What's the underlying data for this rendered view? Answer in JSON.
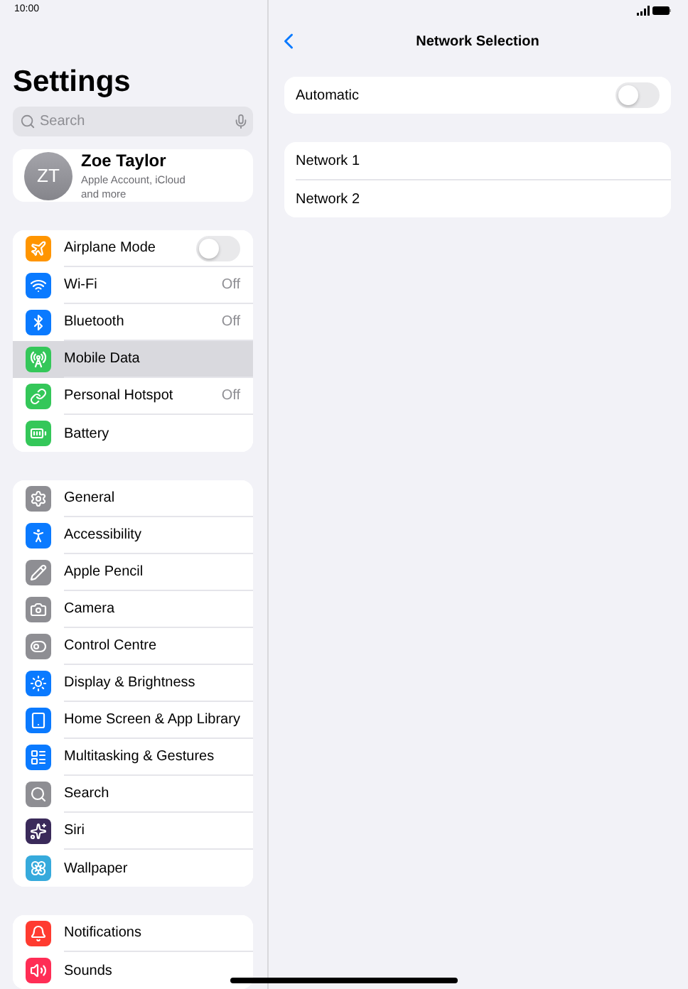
{
  "status_bar": {
    "time": "10:00"
  },
  "sidebar": {
    "title": "Settings",
    "search": {
      "placeholder": "Search"
    },
    "profile": {
      "initials": "ZT",
      "name": "Zoe Taylor",
      "subtitle": "Apple Account, iCloud and more"
    },
    "groups": [
      {
        "items": [
          {
            "label": "Airplane Mode",
            "kind": "toggle",
            "on": false,
            "selected": false,
            "color": "#ff9500"
          },
          {
            "label": "Wi-Fi",
            "kind": "value",
            "value": "Off",
            "selected": false,
            "color": "#0a7aff"
          },
          {
            "label": "Bluetooth",
            "kind": "value",
            "value": "Off",
            "selected": false,
            "color": "#0a7aff"
          },
          {
            "label": "Mobile Data",
            "kind": "plain",
            "selected": true,
            "color": "#34c759"
          },
          {
            "label": "Personal Hotspot",
            "kind": "value",
            "value": "Off",
            "selected": false,
            "color": "#34c759"
          },
          {
            "label": "Battery",
            "kind": "plain",
            "selected": false,
            "color": "#34c759"
          }
        ]
      },
      {
        "items": [
          {
            "label": "General",
            "kind": "plain",
            "selected": false,
            "color": "#8e8e93"
          },
          {
            "label": "Accessibility",
            "kind": "plain",
            "selected": false,
            "color": "#0a7aff"
          },
          {
            "label": "Apple Pencil",
            "kind": "plain",
            "selected": false,
            "color": "#8e8e93"
          },
          {
            "label": "Camera",
            "kind": "plain",
            "selected": false,
            "color": "#8e8e93"
          },
          {
            "label": "Control Centre",
            "kind": "plain",
            "selected": false,
            "color": "#8e8e93"
          },
          {
            "label": "Display & Brightness",
            "kind": "plain",
            "selected": false,
            "color": "#0a7aff"
          },
          {
            "label": "Home Screen & App Library",
            "kind": "plain",
            "selected": false,
            "color": "#0a7aff"
          },
          {
            "label": "Multitasking & Gestures",
            "kind": "plain",
            "selected": false,
            "color": "#0a7aff"
          },
          {
            "label": "Search",
            "kind": "plain",
            "selected": false,
            "color": "#8e8e93"
          },
          {
            "label": "Siri",
            "kind": "plain",
            "selected": false,
            "color": "#3a2a5a"
          },
          {
            "label": "Wallpaper",
            "kind": "plain",
            "selected": false,
            "color": "#36aadc"
          }
        ]
      },
      {
        "items": [
          {
            "label": "Notifications",
            "kind": "plain",
            "selected": false,
            "color": "#ff3b30"
          },
          {
            "label": "Sounds",
            "kind": "plain",
            "selected": false,
            "color": "#ff2d55"
          }
        ]
      }
    ]
  },
  "detail": {
    "title": "Network Selection",
    "automatic": {
      "label": "Automatic",
      "on": false
    },
    "networks": [
      {
        "label": "Network 1"
      },
      {
        "label": "Network 2"
      }
    ]
  }
}
